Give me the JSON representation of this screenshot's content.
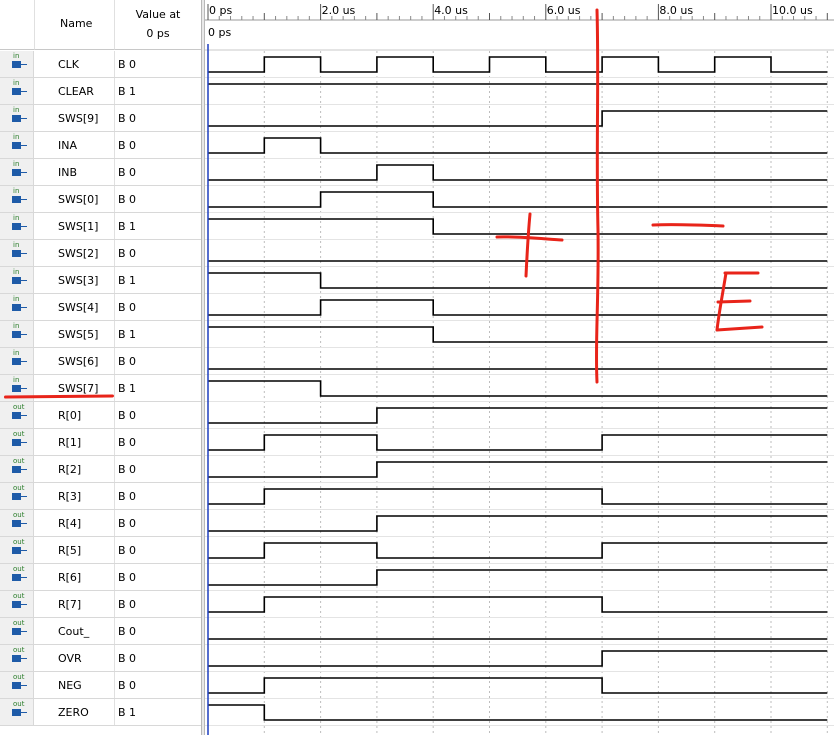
{
  "header": {
    "name_label": "Name",
    "value_label_line1": "Value at",
    "value_label_line2": "0 ps"
  },
  "timeline": {
    "ticks": [
      "0 ps",
      "2.0 us",
      "4.0 us",
      "6.0 us",
      "8.0 us",
      "10.0 us"
    ],
    "cursor_label": "0 ps"
  },
  "signals": [
    {
      "name": "CLK",
      "dir": "in",
      "value": "B 0",
      "wave": [
        0,
        1,
        0,
        1,
        0,
        1,
        0,
        1,
        0,
        1,
        0
      ]
    },
    {
      "name": "CLEAR",
      "dir": "in",
      "value": "B 1",
      "wave": [
        1,
        1,
        1,
        1,
        1,
        1,
        1,
        1,
        1,
        1,
        1
      ]
    },
    {
      "name": "SWS[9]",
      "dir": "in",
      "value": "B 0",
      "wave": [
        0,
        0,
        0,
        0,
        0,
        0,
        0,
        1,
        1,
        1,
        1
      ]
    },
    {
      "name": "INA",
      "dir": "in",
      "value": "B 0",
      "wave": [
        0,
        1,
        0,
        0,
        0,
        0,
        0,
        0,
        0,
        0,
        0
      ]
    },
    {
      "name": "INB",
      "dir": "in",
      "value": "B 0",
      "wave": [
        0,
        0,
        0,
        1,
        0,
        0,
        0,
        0,
        0,
        0,
        0
      ]
    },
    {
      "name": "SWS[0]",
      "dir": "in",
      "value": "B 0",
      "wave": [
        0,
        0,
        1,
        1,
        0,
        0,
        0,
        0,
        0,
        0,
        0
      ]
    },
    {
      "name": "SWS[1]",
      "dir": "in",
      "value": "B 1",
      "wave": [
        1,
        1,
        1,
        1,
        0,
        0,
        0,
        0,
        0,
        0,
        0
      ]
    },
    {
      "name": "SWS[2]",
      "dir": "in",
      "value": "B 0",
      "wave": [
        0,
        0,
        0,
        0,
        0,
        0,
        0,
        0,
        0,
        0,
        0
      ]
    },
    {
      "name": "SWS[3]",
      "dir": "in",
      "value": "B 1",
      "wave": [
        1,
        1,
        0,
        0,
        0,
        0,
        0,
        0,
        0,
        0,
        0
      ]
    },
    {
      "name": "SWS[4]",
      "dir": "in",
      "value": "B 0",
      "wave": [
        0,
        0,
        1,
        1,
        0,
        0,
        0,
        0,
        0,
        0,
        0
      ]
    },
    {
      "name": "SWS[5]",
      "dir": "in",
      "value": "B 1",
      "wave": [
        1,
        1,
        1,
        1,
        0,
        0,
        0,
        0,
        0,
        0,
        0
      ]
    },
    {
      "name": "SWS[6]",
      "dir": "in",
      "value": "B 0",
      "wave": [
        0,
        0,
        0,
        0,
        0,
        0,
        0,
        0,
        0,
        0,
        0
      ]
    },
    {
      "name": "SWS[7]",
      "dir": "in",
      "value": "B 1",
      "wave": [
        1,
        1,
        0,
        0,
        0,
        0,
        0,
        0,
        0,
        0,
        0
      ]
    },
    {
      "name": "R[0]",
      "dir": "out",
      "value": "B 0",
      "wave": [
        0,
        0,
        0,
        1,
        1,
        1,
        1,
        1,
        1,
        1,
        1
      ]
    },
    {
      "name": "R[1]",
      "dir": "out",
      "value": "B 0",
      "wave": [
        0,
        1,
        1,
        0,
        0,
        0,
        0,
        1,
        1,
        1,
        1
      ]
    },
    {
      "name": "R[2]",
      "dir": "out",
      "value": "B 0",
      "wave": [
        0,
        0,
        0,
        1,
        1,
        1,
        1,
        1,
        1,
        1,
        1
      ]
    },
    {
      "name": "R[3]",
      "dir": "out",
      "value": "B 0",
      "wave": [
        0,
        1,
        1,
        1,
        1,
        1,
        1,
        0,
        0,
        0,
        0
      ]
    },
    {
      "name": "R[4]",
      "dir": "out",
      "value": "B 0",
      "wave": [
        0,
        0,
        0,
        1,
        1,
        1,
        1,
        1,
        1,
        1,
        1
      ]
    },
    {
      "name": "R[5]",
      "dir": "out",
      "value": "B 0",
      "wave": [
        0,
        1,
        1,
        0,
        0,
        0,
        0,
        1,
        1,
        1,
        1
      ]
    },
    {
      "name": "R[6]",
      "dir": "out",
      "value": "B 0",
      "wave": [
        0,
        0,
        0,
        1,
        1,
        1,
        1,
        1,
        1,
        1,
        1
      ]
    },
    {
      "name": "R[7]",
      "dir": "out",
      "value": "B 0",
      "wave": [
        0,
        1,
        1,
        1,
        1,
        1,
        1,
        0,
        0,
        0,
        0
      ]
    },
    {
      "name": "Cout_",
      "dir": "out",
      "value": "B 0",
      "wave": [
        0,
        0,
        0,
        0,
        0,
        0,
        0,
        0,
        0,
        0,
        0
      ]
    },
    {
      "name": "OVR",
      "dir": "out",
      "value": "B 0",
      "wave": [
        0,
        0,
        0,
        0,
        0,
        0,
        0,
        1,
        1,
        1,
        1
      ]
    },
    {
      "name": "NEG",
      "dir": "out",
      "value": "B 0",
      "wave": [
        0,
        1,
        1,
        1,
        1,
        1,
        1,
        0,
        0,
        0,
        0
      ]
    },
    {
      "name": "ZERO",
      "dir": "out",
      "value": "B 1",
      "wave": [
        1,
        0,
        0,
        0,
        0,
        0,
        0,
        0,
        0,
        0,
        0
      ]
    }
  ],
  "annotations": {
    "plus_mark": "+",
    "minus_mark": "−",
    "e_mark": "E",
    "color": "#e8241a"
  },
  "colors": {
    "wave": "#000000",
    "grid": "#bdbdbd",
    "cursor": "#1f3fbf",
    "icon_in": "#1e5ba8"
  }
}
